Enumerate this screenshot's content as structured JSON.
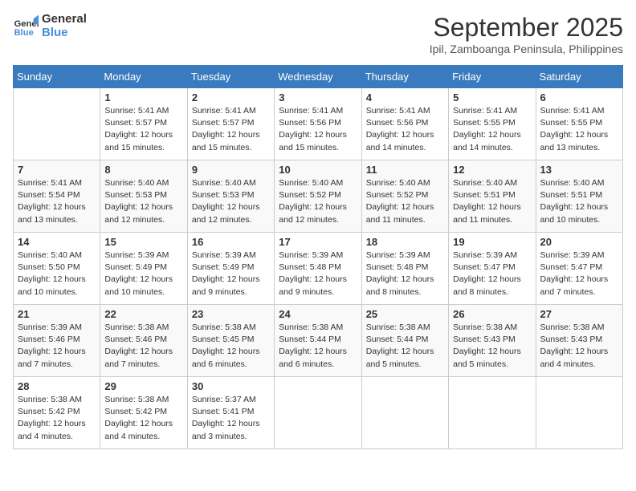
{
  "logo": {
    "line1": "General",
    "line2": "Blue"
  },
  "title": "September 2025",
  "subtitle": "Ipil, Zamboanga Peninsula, Philippines",
  "days_of_week": [
    "Sunday",
    "Monday",
    "Tuesday",
    "Wednesday",
    "Thursday",
    "Friday",
    "Saturday"
  ],
  "weeks": [
    [
      null,
      {
        "date": "1",
        "sunrise": "Sunrise: 5:41 AM",
        "sunset": "Sunset: 5:57 PM",
        "daylight": "Daylight: 12 hours and 15 minutes."
      },
      {
        "date": "2",
        "sunrise": "Sunrise: 5:41 AM",
        "sunset": "Sunset: 5:57 PM",
        "daylight": "Daylight: 12 hours and 15 minutes."
      },
      {
        "date": "3",
        "sunrise": "Sunrise: 5:41 AM",
        "sunset": "Sunset: 5:56 PM",
        "daylight": "Daylight: 12 hours and 15 minutes."
      },
      {
        "date": "4",
        "sunrise": "Sunrise: 5:41 AM",
        "sunset": "Sunset: 5:56 PM",
        "daylight": "Daylight: 12 hours and 14 minutes."
      },
      {
        "date": "5",
        "sunrise": "Sunrise: 5:41 AM",
        "sunset": "Sunset: 5:55 PM",
        "daylight": "Daylight: 12 hours and 14 minutes."
      },
      {
        "date": "6",
        "sunrise": "Sunrise: 5:41 AM",
        "sunset": "Sunset: 5:55 PM",
        "daylight": "Daylight: 12 hours and 13 minutes."
      }
    ],
    [
      {
        "date": "7",
        "sunrise": "Sunrise: 5:41 AM",
        "sunset": "Sunset: 5:54 PM",
        "daylight": "Daylight: 12 hours and 13 minutes."
      },
      {
        "date": "8",
        "sunrise": "Sunrise: 5:40 AM",
        "sunset": "Sunset: 5:53 PM",
        "daylight": "Daylight: 12 hours and 12 minutes."
      },
      {
        "date": "9",
        "sunrise": "Sunrise: 5:40 AM",
        "sunset": "Sunset: 5:53 PM",
        "daylight": "Daylight: 12 hours and 12 minutes."
      },
      {
        "date": "10",
        "sunrise": "Sunrise: 5:40 AM",
        "sunset": "Sunset: 5:52 PM",
        "daylight": "Daylight: 12 hours and 12 minutes."
      },
      {
        "date": "11",
        "sunrise": "Sunrise: 5:40 AM",
        "sunset": "Sunset: 5:52 PM",
        "daylight": "Daylight: 12 hours and 11 minutes."
      },
      {
        "date": "12",
        "sunrise": "Sunrise: 5:40 AM",
        "sunset": "Sunset: 5:51 PM",
        "daylight": "Daylight: 12 hours and 11 minutes."
      },
      {
        "date": "13",
        "sunrise": "Sunrise: 5:40 AM",
        "sunset": "Sunset: 5:51 PM",
        "daylight": "Daylight: 12 hours and 10 minutes."
      }
    ],
    [
      {
        "date": "14",
        "sunrise": "Sunrise: 5:40 AM",
        "sunset": "Sunset: 5:50 PM",
        "daylight": "Daylight: 12 hours and 10 minutes."
      },
      {
        "date": "15",
        "sunrise": "Sunrise: 5:39 AM",
        "sunset": "Sunset: 5:49 PM",
        "daylight": "Daylight: 12 hours and 10 minutes."
      },
      {
        "date": "16",
        "sunrise": "Sunrise: 5:39 AM",
        "sunset": "Sunset: 5:49 PM",
        "daylight": "Daylight: 12 hours and 9 minutes."
      },
      {
        "date": "17",
        "sunrise": "Sunrise: 5:39 AM",
        "sunset": "Sunset: 5:48 PM",
        "daylight": "Daylight: 12 hours and 9 minutes."
      },
      {
        "date": "18",
        "sunrise": "Sunrise: 5:39 AM",
        "sunset": "Sunset: 5:48 PM",
        "daylight": "Daylight: 12 hours and 8 minutes."
      },
      {
        "date": "19",
        "sunrise": "Sunrise: 5:39 AM",
        "sunset": "Sunset: 5:47 PM",
        "daylight": "Daylight: 12 hours and 8 minutes."
      },
      {
        "date": "20",
        "sunrise": "Sunrise: 5:39 AM",
        "sunset": "Sunset: 5:47 PM",
        "daylight": "Daylight: 12 hours and 7 minutes."
      }
    ],
    [
      {
        "date": "21",
        "sunrise": "Sunrise: 5:39 AM",
        "sunset": "Sunset: 5:46 PM",
        "daylight": "Daylight: 12 hours and 7 minutes."
      },
      {
        "date": "22",
        "sunrise": "Sunrise: 5:38 AM",
        "sunset": "Sunset: 5:46 PM",
        "daylight": "Daylight: 12 hours and 7 minutes."
      },
      {
        "date": "23",
        "sunrise": "Sunrise: 5:38 AM",
        "sunset": "Sunset: 5:45 PM",
        "daylight": "Daylight: 12 hours and 6 minutes."
      },
      {
        "date": "24",
        "sunrise": "Sunrise: 5:38 AM",
        "sunset": "Sunset: 5:44 PM",
        "daylight": "Daylight: 12 hours and 6 minutes."
      },
      {
        "date": "25",
        "sunrise": "Sunrise: 5:38 AM",
        "sunset": "Sunset: 5:44 PM",
        "daylight": "Daylight: 12 hours and 5 minutes."
      },
      {
        "date": "26",
        "sunrise": "Sunrise: 5:38 AM",
        "sunset": "Sunset: 5:43 PM",
        "daylight": "Daylight: 12 hours and 5 minutes."
      },
      {
        "date": "27",
        "sunrise": "Sunrise: 5:38 AM",
        "sunset": "Sunset: 5:43 PM",
        "daylight": "Daylight: 12 hours and 4 minutes."
      }
    ],
    [
      {
        "date": "28",
        "sunrise": "Sunrise: 5:38 AM",
        "sunset": "Sunset: 5:42 PM",
        "daylight": "Daylight: 12 hours and 4 minutes."
      },
      {
        "date": "29",
        "sunrise": "Sunrise: 5:38 AM",
        "sunset": "Sunset: 5:42 PM",
        "daylight": "Daylight: 12 hours and 4 minutes."
      },
      {
        "date": "30",
        "sunrise": "Sunrise: 5:37 AM",
        "sunset": "Sunset: 5:41 PM",
        "daylight": "Daylight: 12 hours and 3 minutes."
      },
      null,
      null,
      null,
      null
    ]
  ]
}
